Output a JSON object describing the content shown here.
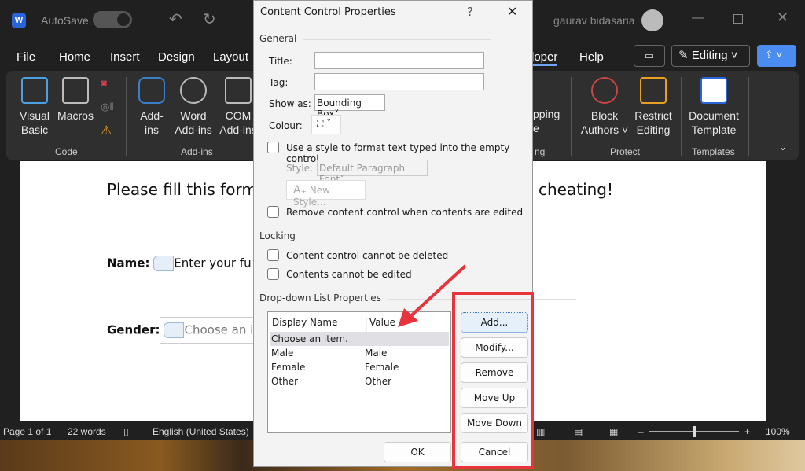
{
  "app": {
    "autosave": "AutoSave",
    "user": "gaurav bidasaria",
    "editing": "Editing"
  },
  "menu": [
    "File",
    "Home",
    "Insert",
    "Design",
    "Layout",
    "loper",
    "Help"
  ],
  "ribbon": {
    "code": {
      "visual_basic": "Visual Basic",
      "macros": "Macros",
      "group": "Code"
    },
    "addins": {
      "addins": "Add-ins",
      "word_addins": "Word Add-ins",
      "com_addins": "COM Add-ins",
      "group": "Add-ins"
    },
    "mapping": {
      "label": "pping",
      "label2": "e",
      "group": "ng"
    },
    "protect": {
      "block_authors": "Block Authors",
      "restrict_editing": "Restrict Editing",
      "group": "Protect"
    },
    "templates": {
      "document_template": "Document Template",
      "group": "Templates"
    }
  },
  "document": {
    "heading_left": "Please fill this form",
    "heading_right": "cheating!",
    "name_label": "Name:",
    "name_placeholder": "Enter your fu",
    "gender_label": "Gender:",
    "gender_placeholder": "Choose an ite"
  },
  "status": {
    "page": "Page 1 of 1",
    "words": "22 words",
    "language": "English (United States)",
    "zoom": "100%"
  },
  "dialog": {
    "title": "Content Control Properties",
    "help": "?",
    "close": "✕",
    "general": "General",
    "title_label": "Title:",
    "title_value": "",
    "tag_label": "Tag:",
    "tag_value": "",
    "show_as_label": "Show as:",
    "show_as_value": "Bounding Box",
    "colour_label": "Colour:",
    "use_style": "Use a style to format text typed into the empty control",
    "style_label": "Style:",
    "style_value": "Default Paragraph Font",
    "new_style": "New Style...",
    "remove_cc": "Remove content control when contents are edited",
    "locking": "Locking",
    "cannot_delete": "Content control cannot be deleted",
    "cannot_edit": "Contents cannot be edited",
    "dropdown": "Drop-down List Properties",
    "columns": [
      "Display Name",
      "Value"
    ],
    "rows": [
      [
        "Choose an item.",
        ""
      ],
      [
        "Male",
        "Male"
      ],
      [
        "Female",
        "Female"
      ],
      [
        "Other",
        "Other"
      ]
    ],
    "buttons": {
      "add": "Add...",
      "modify": "Modify...",
      "remove": "Remove",
      "move_up": "Move Up",
      "move_down": "Move Down",
      "ok": "OK",
      "cancel": "Cancel"
    }
  },
  "colors": {
    "annotation": "#e8343c",
    "share": "#4a8cf0"
  }
}
